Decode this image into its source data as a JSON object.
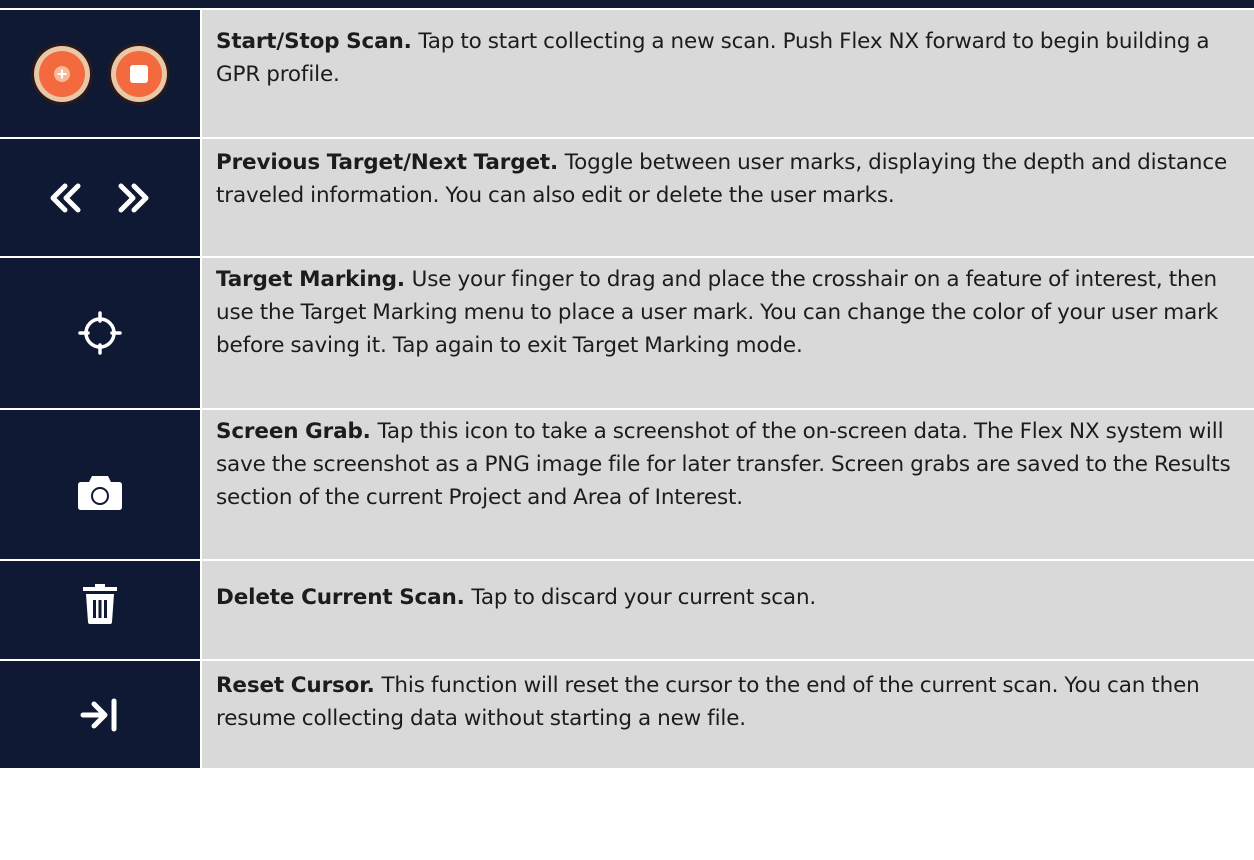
{
  "rows": [
    {
      "icons": [
        "start-scan-icon",
        "stop-scan-icon"
      ],
      "title": "Start/Stop Scan.",
      "description": "Tap to start collecting a new scan. Push Flex NX forward to begin building a GPR profile."
    },
    {
      "icons": [
        "previous-target-icon",
        "next-target-icon"
      ],
      "title": "Previous Target/Next Target.",
      "description": "Toggle between user marks, displaying the depth and distance traveled information. You can also edit or delete the user marks."
    },
    {
      "icons": [
        "crosshair-icon"
      ],
      "title": "Target Marking.",
      "description": "Use your finger to drag and place the crosshair on a feature of interest, then use the Target Marking menu to place a user mark. You can change the color of your user mark before saving it. Tap again to exit Target Marking mode."
    },
    {
      "icons": [
        "camera-icon"
      ],
      "title": "Screen Grab.",
      "description": "Tap this icon to take a screenshot of the on-screen data. The Flex NX system will save the screenshot as a PNG image file for later transfer. Screen grabs are saved to the Results section of the current Project and Area of Interest."
    },
    {
      "icons": [
        "trash-icon"
      ],
      "title": "Delete Current Scan.",
      "description": "Tap to discard your current scan."
    },
    {
      "icons": [
        "reset-cursor-icon"
      ],
      "title": "Reset Cursor.",
      "description": "This function will reset the cursor to the end of the current scan. You can then resume collecting data without starting a new file."
    }
  ],
  "colors": {
    "icon_background": "#0f1933",
    "text_background": "#d9d9d9",
    "scan_button_fill": "#f26a3d",
    "scan_button_ring": "#e8c8a8",
    "icon_foreground": "#ffffff"
  }
}
